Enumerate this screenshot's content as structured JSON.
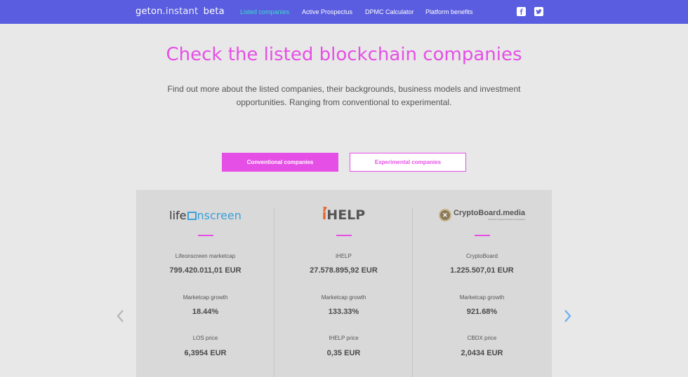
{
  "brand": {
    "name_main": "geton",
    "name_dot": ".",
    "name_rest": "instant",
    "tag": "beta"
  },
  "nav": [
    {
      "label": "Listed companies",
      "active": true
    },
    {
      "label": "Active Prospectus"
    },
    {
      "label": "DPMC Calculator"
    },
    {
      "label": "Platform benefits"
    }
  ],
  "social": [
    {
      "icon": "facebook-icon"
    },
    {
      "icon": "twitter-icon"
    }
  ],
  "hero": {
    "title": "Check the listed blockchain companies",
    "intro_line1": "Find out more about the listed companies, their backgrounds, business models and investment",
    "intro_line2": "opportunities. Ranging from conventional to experimental."
  },
  "tabs": [
    {
      "label": "Conventional companies",
      "selected": true
    },
    {
      "label": "Experimental companies",
      "selected": false
    }
  ],
  "companies": [
    {
      "logo_part1": "life",
      "logo_part2": "nscreen",
      "metric1_label": "Lifeonscreen marketcap",
      "metric1_value": "799.420.011,01 EUR",
      "metric2_label": "Marketcap growth",
      "metric2_value": "18.44%",
      "metric3_label": "LOS price",
      "metric3_value": "6,3954 EUR"
    },
    {
      "logo_text": "HELP",
      "logo_prefix": "i",
      "metric1_label": "iHELP",
      "metric1_value": "27.578.895,92 EUR",
      "metric2_label": "Marketcap growth",
      "metric2_value": "133.33%",
      "metric3_label": "IHELP price",
      "metric3_value": "0,35 EUR"
    },
    {
      "logo_text": "CryptoBoard.media",
      "logo_sub": "All about Cryptocurrencies & innovation",
      "metric1_label": "CryptoBoard",
      "metric1_value": "1.225.507,01 EUR",
      "metric2_label": "Marketcap growth",
      "metric2_value": "921.68%",
      "metric3_label": "CBDX price",
      "metric3_value": "2,0434 EUR"
    }
  ],
  "colors": {
    "nav_bg": "#5a5de0",
    "accent": "#e64fe6",
    "active_nav": "#39e0c8",
    "next_arrow": "#6ab0f0"
  }
}
